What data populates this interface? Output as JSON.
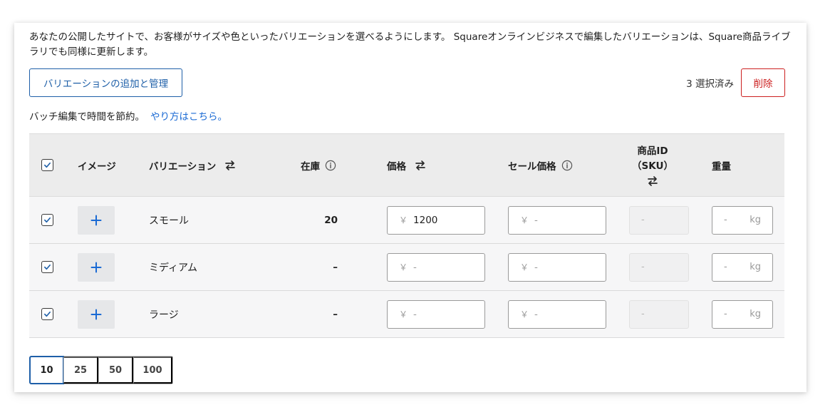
{
  "intro_text": "あなたの公開したサイトで、お客様がサイズや色といったバリエーションを選べるようにします。 Squareオンラインビジネスで編集したバリエーションは、Square商品ライブラリでも同様に更新します。",
  "manage_button": "バリエーションの追加と管理",
  "selected_count": "3 選択済み",
  "delete_button": "削除",
  "batch_note": "バッチ編集で時間を節約。",
  "batch_link": "やり方はこちら。",
  "headers": {
    "image": "イメージ",
    "variation": "バリエーション",
    "stock": "在庫",
    "price": "価格",
    "sale_price": "セール価格",
    "sku_line1": "商品ID",
    "sku_line2": "（SKU）",
    "weight": "重量"
  },
  "icons": {
    "sort": "swap-arrows-icon",
    "info": "info-circle-icon",
    "add": "plus-icon",
    "check": "checkmark-icon"
  },
  "currency_symbol": "￥",
  "weight_unit": "kg",
  "rows": [
    {
      "name": "スモール",
      "stock": "20",
      "price": "1200",
      "price_placeholder": false,
      "sale_price": "-",
      "sku": "-",
      "weight": "-",
      "checked": true
    },
    {
      "name": "ミディアム",
      "stock": "–",
      "price": "-",
      "price_placeholder": true,
      "sale_price": "-",
      "sku": "-",
      "weight": "-",
      "checked": true
    },
    {
      "name": "ラージ",
      "stock": "–",
      "price": "-",
      "price_placeholder": true,
      "sale_price": "-",
      "sku": "-",
      "weight": "-",
      "checked": true
    }
  ],
  "page_sizes": [
    "10",
    "25",
    "50",
    "100"
  ],
  "active_page_size": "10",
  "colors": {
    "accent_blue": "#1e5fa8",
    "link_blue": "#1a6ad4",
    "danger_red": "#cc1f1f",
    "header_bg": "#ececec",
    "row_bg": "#f6f6f7"
  }
}
